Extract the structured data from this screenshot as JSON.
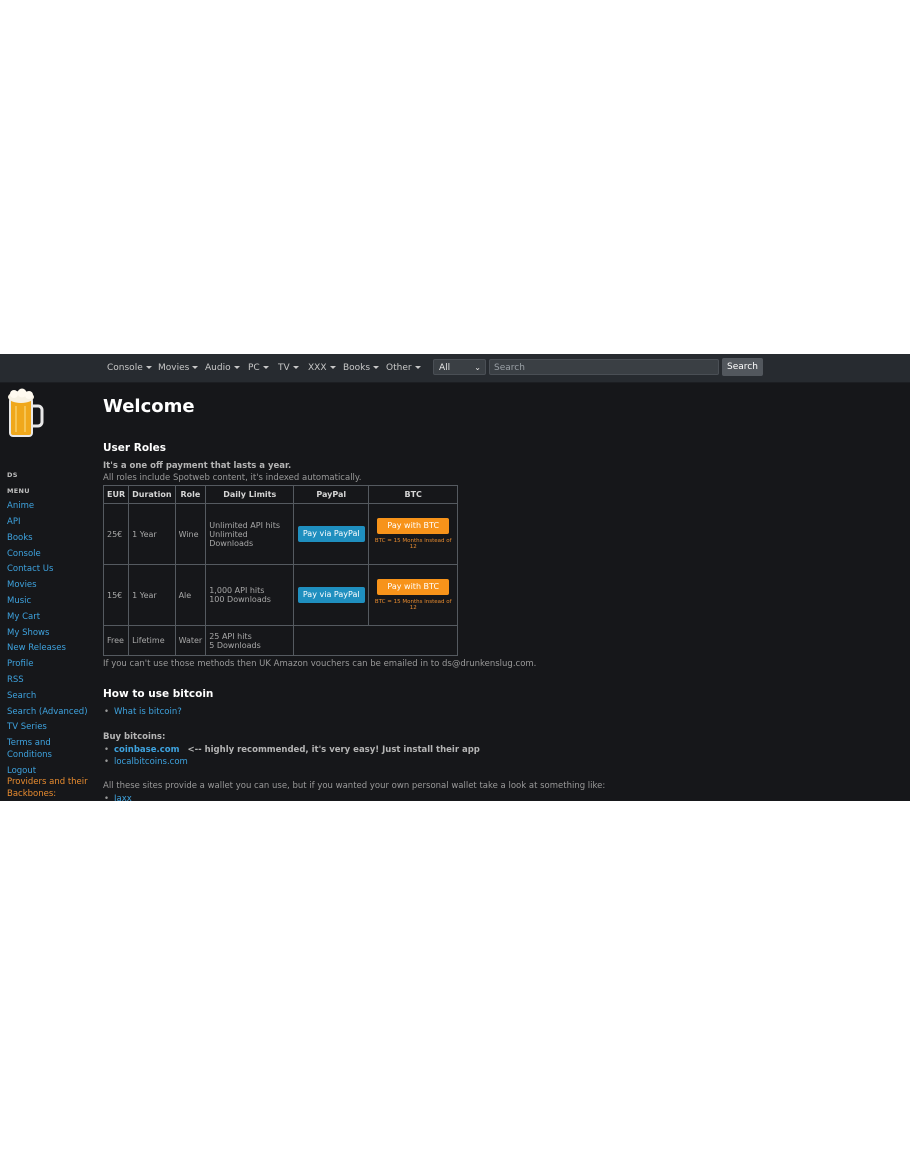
{
  "navbar": {
    "menus": [
      "Console",
      "Movies",
      "Audio",
      "PC",
      "TV",
      "XXX",
      "Books",
      "Other"
    ],
    "category_select": "All",
    "search_placeholder": "Search",
    "search_button": "Search"
  },
  "sidebar": {
    "user": "DS",
    "menu_heading": "MENU",
    "links": [
      "Anime",
      "API",
      "Books",
      "Console",
      "Contact Us",
      "Movies",
      "Music",
      "My Cart",
      "My Shows",
      "New Releases",
      "Profile",
      "RSS",
      "Search",
      "Search (Advanced)",
      "TV Series"
    ],
    "terms_line1": "Terms and",
    "terms_line2": "Conditions",
    "logout": "Logout",
    "providers": "Providers and their Backbones:"
  },
  "main": {
    "title": "Welcome",
    "roles_heading": "User Roles",
    "roles_note1": "It's a one off payment that lasts a year.",
    "roles_note2": "All roles include Spotweb content, it's indexed automatically.",
    "table": {
      "headers": [
        "EUR",
        "Duration",
        "Role",
        "Daily Limits",
        "PayPal",
        "BTC"
      ],
      "rows": [
        {
          "eur": "25€",
          "duration": "1 Year",
          "role": "Wine",
          "limit1": "Unlimited API hits",
          "limit2": "Unlimited Downloads",
          "paypal": "Pay via PayPal",
          "btc": "Pay with BTC",
          "btc_note": "BTC = 15 Months instead of 12"
        },
        {
          "eur": "15€",
          "duration": "1 Year",
          "role": "Ale",
          "limit1": "1,000 API hits",
          "limit2": "100 Downloads",
          "paypal": "Pay via PayPal",
          "btc": "Pay with BTC",
          "btc_note": "BTC = 15 Months instead of 12"
        },
        {
          "eur": "Free",
          "duration": "Lifetime",
          "role": "Water",
          "limit1": "25 API hits",
          "limit2": "5 Downloads"
        }
      ]
    },
    "amazon_note": "If you can't use those methods then UK Amazon vouchers can be emailed in to ds@drunkenslug.com.",
    "bitcoin_heading": "How to use bitcoin",
    "what_is_bitcoin": "What is bitcoin?",
    "buy_heading": "Buy bitcoins:",
    "coinbase": "coinbase.com",
    "coinbase_note": "<-- highly recommended, it's very easy! Just install their app",
    "localbitcoins": "localbitcoins.com",
    "wallet_note": "All these sites provide a wallet you can use, but if you wanted your own personal wallet take a look at something like:",
    "jaxx": "Jaxx"
  },
  "colors": {
    "background": "#16171a",
    "navbar": "#272b30",
    "link": "#3ea3df",
    "paypal": "#1f8fbf",
    "btc": "#f7931a",
    "accent_orange": "#e98c2f"
  }
}
